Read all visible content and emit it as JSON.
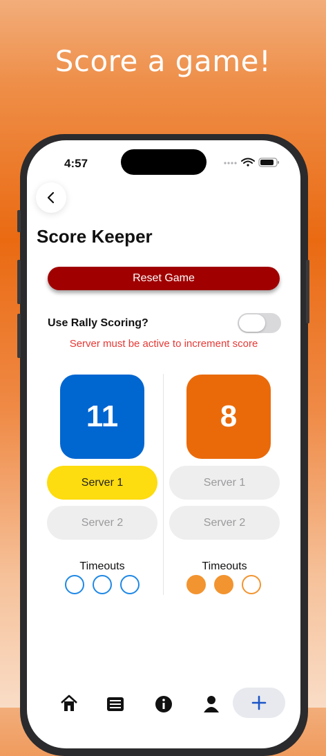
{
  "headline": "Score a game!",
  "status": {
    "time": "4:57"
  },
  "page": {
    "title": "Score Keeper"
  },
  "actions": {
    "reset_label": "Reset Game"
  },
  "rally": {
    "label": "Use Rally Scoring?",
    "enabled": false,
    "warning": "Server must be active to increment score"
  },
  "teams": [
    {
      "score": "11",
      "color": "#0066d0",
      "server1": "Server 1",
      "server2": "Server 2",
      "active_server": 1,
      "timeouts_label": "Timeouts",
      "timeouts_used": 0,
      "timeouts_total": 3,
      "timeout_color": "#1e88e5"
    },
    {
      "score": "8",
      "color": "#ea6a0a",
      "server1": "Server 1",
      "server2": "Server 2",
      "active_server": 0,
      "timeouts_label": "Timeouts",
      "timeouts_used": 2,
      "timeouts_total": 3,
      "timeout_color": "#f29430"
    }
  ],
  "tabbar": {
    "icons": [
      "home-icon",
      "list-icon",
      "info-icon",
      "person-icon",
      "plus-icon"
    ]
  },
  "colors": {
    "reset": "#a00000",
    "active_server": "#fddc10",
    "warning": "#e53935"
  }
}
